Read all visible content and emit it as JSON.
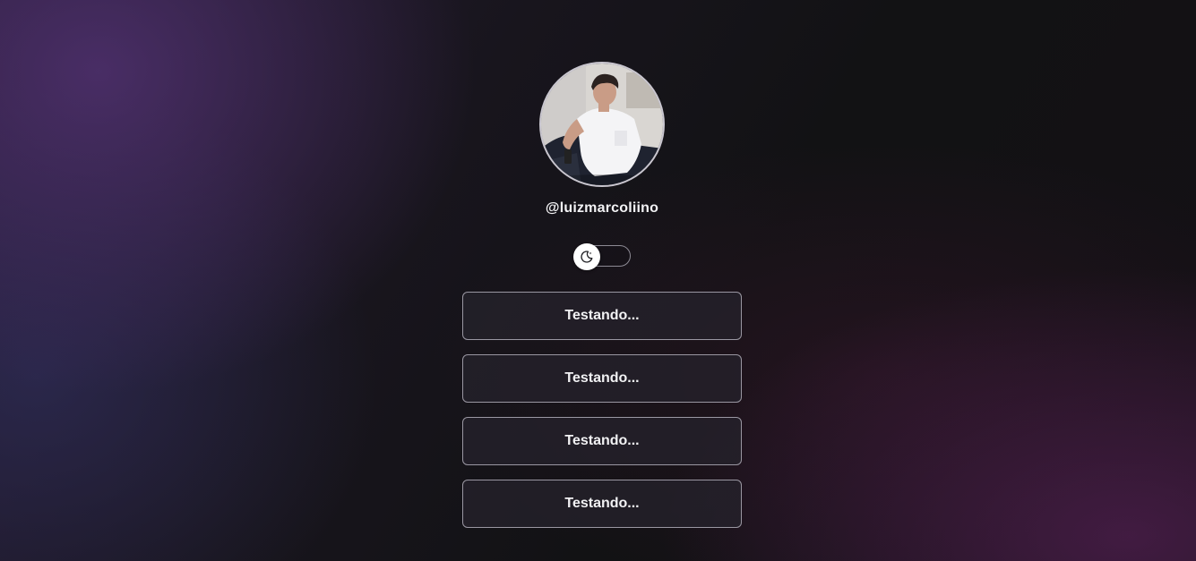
{
  "profile": {
    "handle": "@luizmarcoliino",
    "avatar_icon": "profile-photo"
  },
  "theme_toggle": {
    "icon": "moon-icon",
    "state": "dark"
  },
  "links": [
    {
      "label": "Testando..."
    },
    {
      "label": "Testando..."
    },
    {
      "label": "Testando..."
    },
    {
      "label": "Testando..."
    }
  ],
  "colors": {
    "background": "#111114",
    "button_border": "#9a97a2",
    "text": "#f2f2f4"
  }
}
